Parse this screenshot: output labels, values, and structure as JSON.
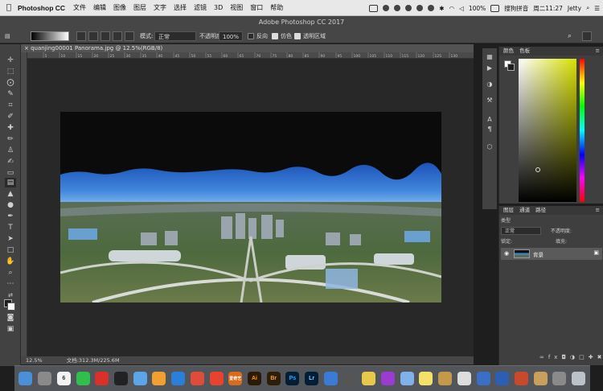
{
  "menubar": {
    "apple_icon": "apple-icon",
    "app_name": "Photoshop CC",
    "items": [
      "文件",
      "编辑",
      "图像",
      "图层",
      "文字",
      "选择",
      "滤镜",
      "3D",
      "视图",
      "窗口",
      "帮助"
    ],
    "battery": "100%",
    "input_method": "搜狗拼音",
    "clock": "周二11:27",
    "user": "Jetty"
  },
  "window": {
    "title": "Adobe Photoshop CC 2017"
  },
  "options": {
    "mode_label": "模式:",
    "mode_value": "正常",
    "opacity_label": "不透明度:",
    "opacity_value": "100%",
    "reverse_label": "反向",
    "dither_label": "仿色",
    "transparency_label": "透明区域"
  },
  "document": {
    "tab_label": "quanjing00001 Panorama.jpg @ 12.5%(RGB/8)",
    "ruler_ticks": [
      "5",
      "10",
      "15",
      "20",
      "25",
      "30",
      "35",
      "40",
      "45",
      "50",
      "55",
      "60",
      "65",
      "70",
      "75",
      "80",
      "85",
      "90",
      "95",
      "100",
      "105",
      "110",
      "115",
      "120",
      "125",
      "130"
    ],
    "zoom": "12.5%",
    "doc_info": "文档:312.3M/225.6M"
  },
  "color_panel": {
    "tabs": [
      "颜色",
      "色板"
    ]
  },
  "layers_panel": {
    "tabs": [
      "图层",
      "通道",
      "路径"
    ],
    "filter_label": "类型",
    "blend_mode": "正常",
    "opacity_label": "不透明度:",
    "lock_label": "锁定:",
    "fill_label": "填充:",
    "layer_name": "背景"
  },
  "colors": {
    "foreground": "#ffffff",
    "background": "#1e1e1e",
    "sky_top": "#1d52b8",
    "sky_bottom": "#5fa0e8"
  },
  "dock": {
    "apps": [
      "finder-icon",
      "launchpad-icon",
      "calendar-icon",
      "wechat-icon",
      "music-163-icon",
      "qq-icon",
      "app-store-icon",
      "photos-icon",
      "safari-icon",
      "chrome-icon",
      "netease-icon",
      "iqiyi-icon",
      "illustrator-icon",
      "bridge-icon",
      "photoshop-icon",
      "lightroom-icon",
      "info-icon",
      "final-cut-icon",
      "stickies-icon",
      "davinci-icon",
      "preview-icon",
      "notes-icon",
      "mosaic-icon",
      "font-icon",
      "app-icon",
      "word-icon",
      "powerpoint-icon",
      "books-icon",
      "system-prefs-icon",
      "trash-icon"
    ],
    "labels": [
      "",
      "",
      "6",
      "",
      "",
      "",
      "",
      "",
      "",
      "",
      "",
      "爱奇艺",
      "Ai",
      "Br",
      "Ps",
      "Lr",
      "",
      "",
      "",
      "",
      "",
      "",
      "",
      "",
      "",
      "",
      "",
      "",
      "",
      ""
    ]
  }
}
